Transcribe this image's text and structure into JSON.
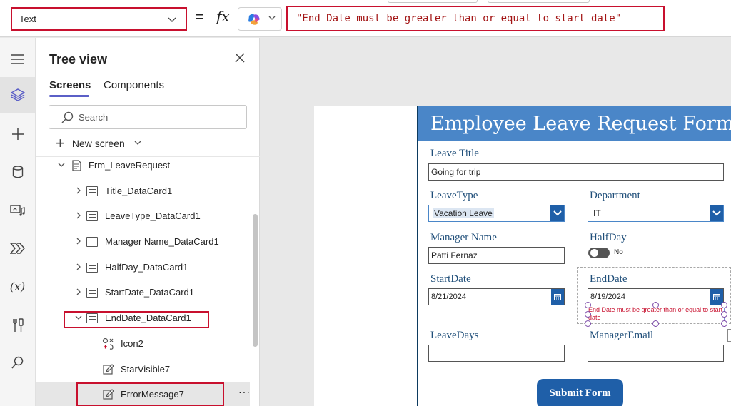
{
  "formula_bar": {
    "property": "Text",
    "equals": "=",
    "fx": "fx",
    "formula": "\"End Date must be greater than or equal to start date\""
  },
  "rail": {
    "icons": [
      "hamburger-icon",
      "layers-icon",
      "plus-icon",
      "database-icon",
      "media-icon",
      "power-automate-icon",
      "variables-icon",
      "tools-icon",
      "search-icon"
    ],
    "variables_glyph": "(x)"
  },
  "tree": {
    "title": "Tree view",
    "tabs": [
      "Screens",
      "Components"
    ],
    "search_placeholder": "Search",
    "new_screen": "New screen",
    "items": [
      {
        "label": "Frm_LeaveRequest"
      },
      {
        "label": "Title_DataCard1"
      },
      {
        "label": "LeaveType_DataCard1"
      },
      {
        "label": "Manager Name_DataCard1"
      },
      {
        "label": "HalfDay_DataCard1"
      },
      {
        "label": "StartDate_DataCard1"
      },
      {
        "label": "EndDate_DataCard1"
      },
      {
        "label": "Icon2"
      },
      {
        "label": "StarVisible7"
      },
      {
        "label": "ErrorMessage7"
      }
    ],
    "more": "···"
  },
  "form": {
    "title": "Employee Leave Request Form",
    "leave_title_label": "Leave Title",
    "leave_title_value": "Going for trip",
    "leave_type_label": "LeaveType",
    "leave_type_value": "Vacation Leave",
    "department_label": "Department",
    "department_value": "IT",
    "manager_name_label": "Manager Name",
    "manager_name_value": "Patti Fernaz",
    "halfday_label": "HalfDay",
    "halfday_value": "No",
    "start_date_label": "StartDate",
    "start_date_value": "8/21/2024",
    "end_date_label": "EndDate",
    "end_date_value": "8/19/2024",
    "error_message": "End Date must be greater than or equal to start date",
    "leave_days_label": "LeaveDays",
    "leave_days_value": "",
    "manager_email_label": "ManagerEmail",
    "manager_email_value": "",
    "submit_label": "Submit Form"
  },
  "colors": {
    "accent": "#5b5fc7",
    "highlight_red": "#c8102e",
    "form_header": "#4a86c8",
    "button_blue": "#1f5fa8",
    "label_blue": "#1f4e79"
  }
}
